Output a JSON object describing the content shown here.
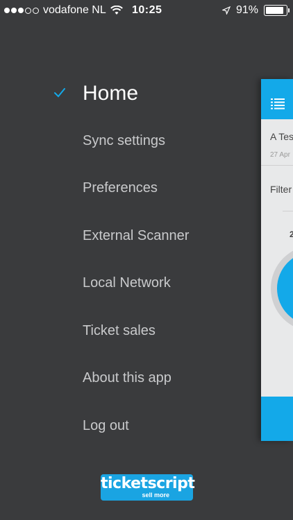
{
  "status_bar": {
    "carrier": "vodafone NL",
    "time": "10:25",
    "battery": "91%",
    "battery_level": 0.91,
    "signal_dots": [
      true,
      true,
      true,
      false,
      false
    ]
  },
  "menu": {
    "items": [
      {
        "label": "Home",
        "active": true
      },
      {
        "label": "Sync settings",
        "active": false
      },
      {
        "label": "Preferences",
        "active": false
      },
      {
        "label": "External Scanner",
        "active": false
      },
      {
        "label": "Local Network",
        "active": false
      },
      {
        "label": "Ticket sales",
        "active": false
      },
      {
        "label": "About this app",
        "active": false
      },
      {
        "label": "Log out",
        "active": false
      }
    ]
  },
  "logo": {
    "brand": "ticketscript",
    "tagline": "sell more"
  },
  "main_panel": {
    "event_title": "A Tes",
    "event_date": "27 Apr",
    "filter_label": "Filter",
    "count": "2"
  },
  "colors": {
    "background": "#3a3b3d",
    "accent": "#13a9e9",
    "menu_text": "#c9cacc"
  },
  "icons": {
    "check": "checkmark-icon",
    "list": "list-icon",
    "wifi": "wifi-icon",
    "location": "location-arrow-icon",
    "battery": "battery-icon"
  }
}
